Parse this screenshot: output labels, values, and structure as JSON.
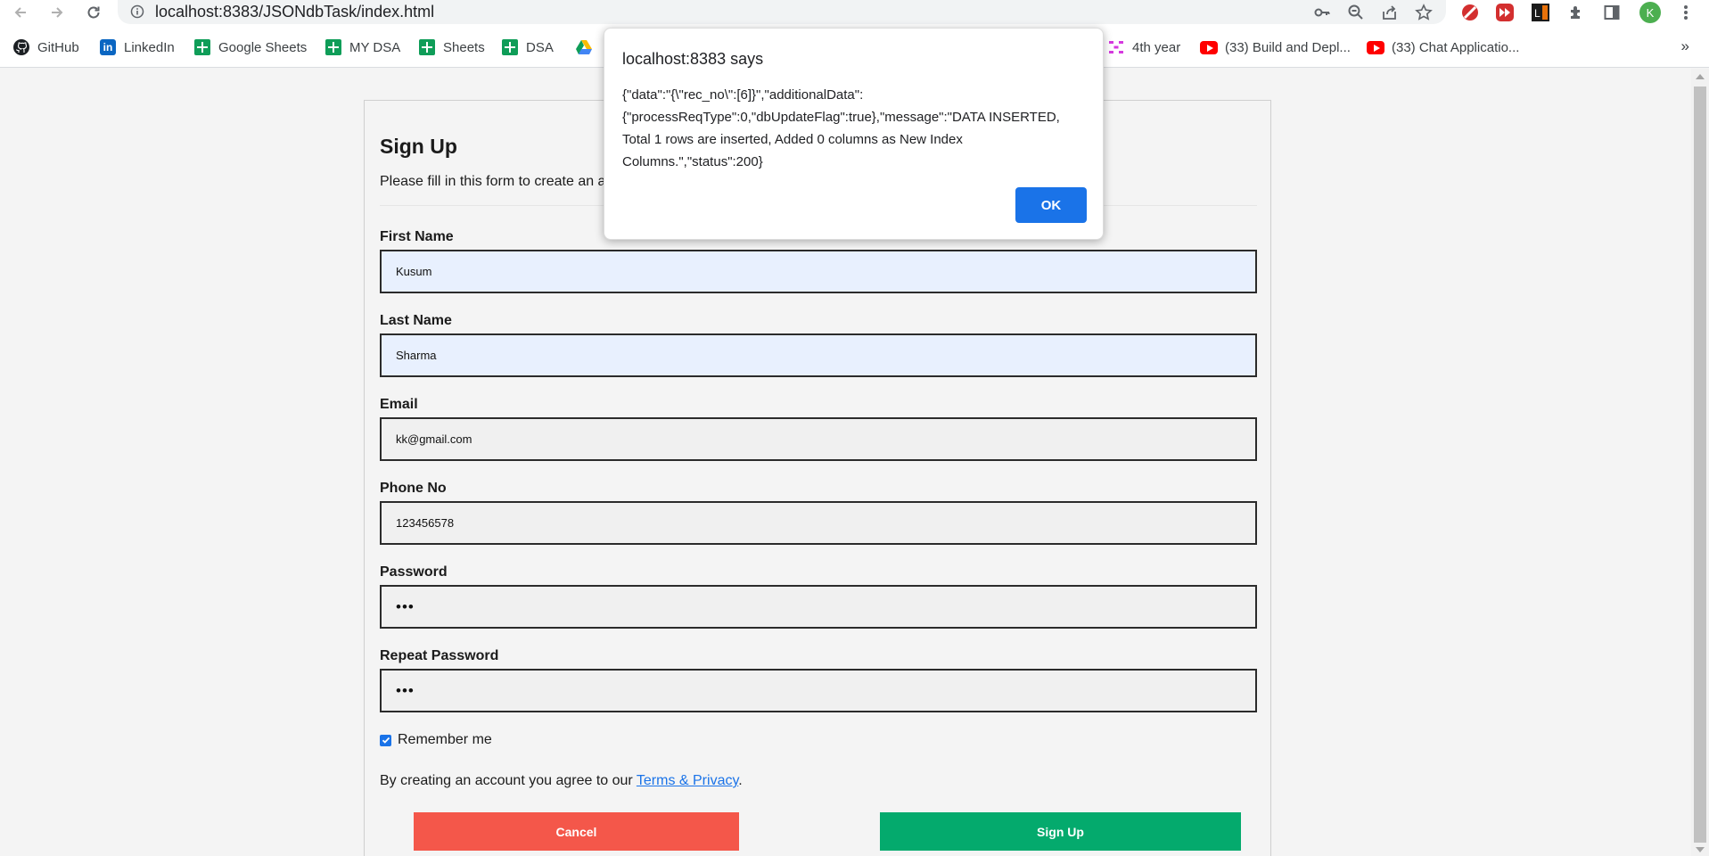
{
  "browser": {
    "url": "localhost:8383/JSONdbTask/index.html",
    "profile_initial": "K",
    "bookmarks": [
      "GitHub",
      "LinkedIn",
      "Google Sheets",
      "MY DSA",
      "Sheets",
      "DSA",
      "4th year",
      "(33) Build and Depl...",
      "(33) Chat Applicatio..."
    ],
    "overflow": "»"
  },
  "alert": {
    "title": "localhost:8383 says",
    "message": "{\"data\":\"{\\\"rec_no\\\":[6]}\",\"additionalData\":{\"processReqType\":0,\"dbUpdateFlag\":true},\"message\":\"DATA INSERTED, Total 1 rows are inserted, Added 0 columns as New Index Columns.\",\"status\":200}",
    "ok_label": "OK"
  },
  "form": {
    "title": "Sign Up",
    "subtitle": "Please fill in this form to create an a",
    "fields": [
      {
        "label": "First Name",
        "value": "Kusum"
      },
      {
        "label": "Last Name",
        "value": "Sharma"
      },
      {
        "label": "Email",
        "value": "kk@gmail.com"
      },
      {
        "label": "Phone No",
        "value": "123456578"
      },
      {
        "label": "Password",
        "value": "•••"
      },
      {
        "label": "Repeat Password",
        "value": "•••"
      }
    ],
    "remember_label": "Remember me",
    "remember_checked": true,
    "terms_prefix": "By creating an account you agree to our ",
    "terms_link": "Terms & Privacy",
    "terms_suffix": ".",
    "cancel_label": "Cancel",
    "signup_label": "Sign Up"
  },
  "colors": {
    "cancel": "#f4574a",
    "signup": "#04aa6d",
    "accent": "#1a73e8",
    "autofill": "#e8f0fe"
  }
}
